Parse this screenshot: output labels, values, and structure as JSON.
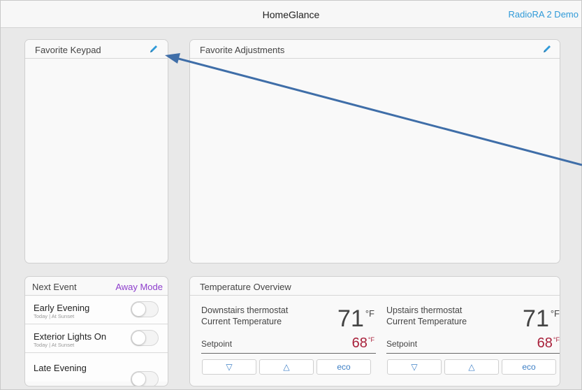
{
  "header": {
    "title": "HomeGlance",
    "demo_link": "RadioRA 2 Demo"
  },
  "favorite_keypad": {
    "title": "Favorite Keypad",
    "edit_icon": "pencil-icon"
  },
  "favorite_adjustments": {
    "title": "Favorite Adjustments",
    "edit_icon": "pencil-icon"
  },
  "next_event": {
    "title": "Next Event",
    "away_mode": "Away Mode",
    "events": [
      {
        "name": "Early Evening",
        "sub": "Today | At Sunset",
        "enabled": false
      },
      {
        "name": "Exterior Lights On",
        "sub": "Today | At Sunset",
        "enabled": false
      },
      {
        "name": "Late Evening",
        "sub": "",
        "enabled": false
      }
    ]
  },
  "temperature_overview": {
    "title": "Temperature Overview",
    "thermostats": [
      {
        "name": "Downstairs thermostat",
        "label": "Current Temperature",
        "temperature": "71",
        "unit": "°F",
        "setpoint_label": "Setpoint",
        "setpoint": "68",
        "setpoint_unit": "°F",
        "buttons": [
          "▽",
          "△",
          "eco"
        ]
      },
      {
        "name": "Upstairs thermostat",
        "label": "Current Temperature",
        "temperature": "71",
        "unit": "°F",
        "setpoint_label": "Setpoint",
        "setpoint": "68",
        "setpoint_unit": "°F",
        "buttons": [
          "▽",
          "△",
          "eco"
        ]
      }
    ]
  },
  "colors": {
    "link": "#2f9ad8",
    "away_mode": "#8d3dcc",
    "setpoint": "#a8203a",
    "annotation_arrow": "#3f6ea8"
  }
}
